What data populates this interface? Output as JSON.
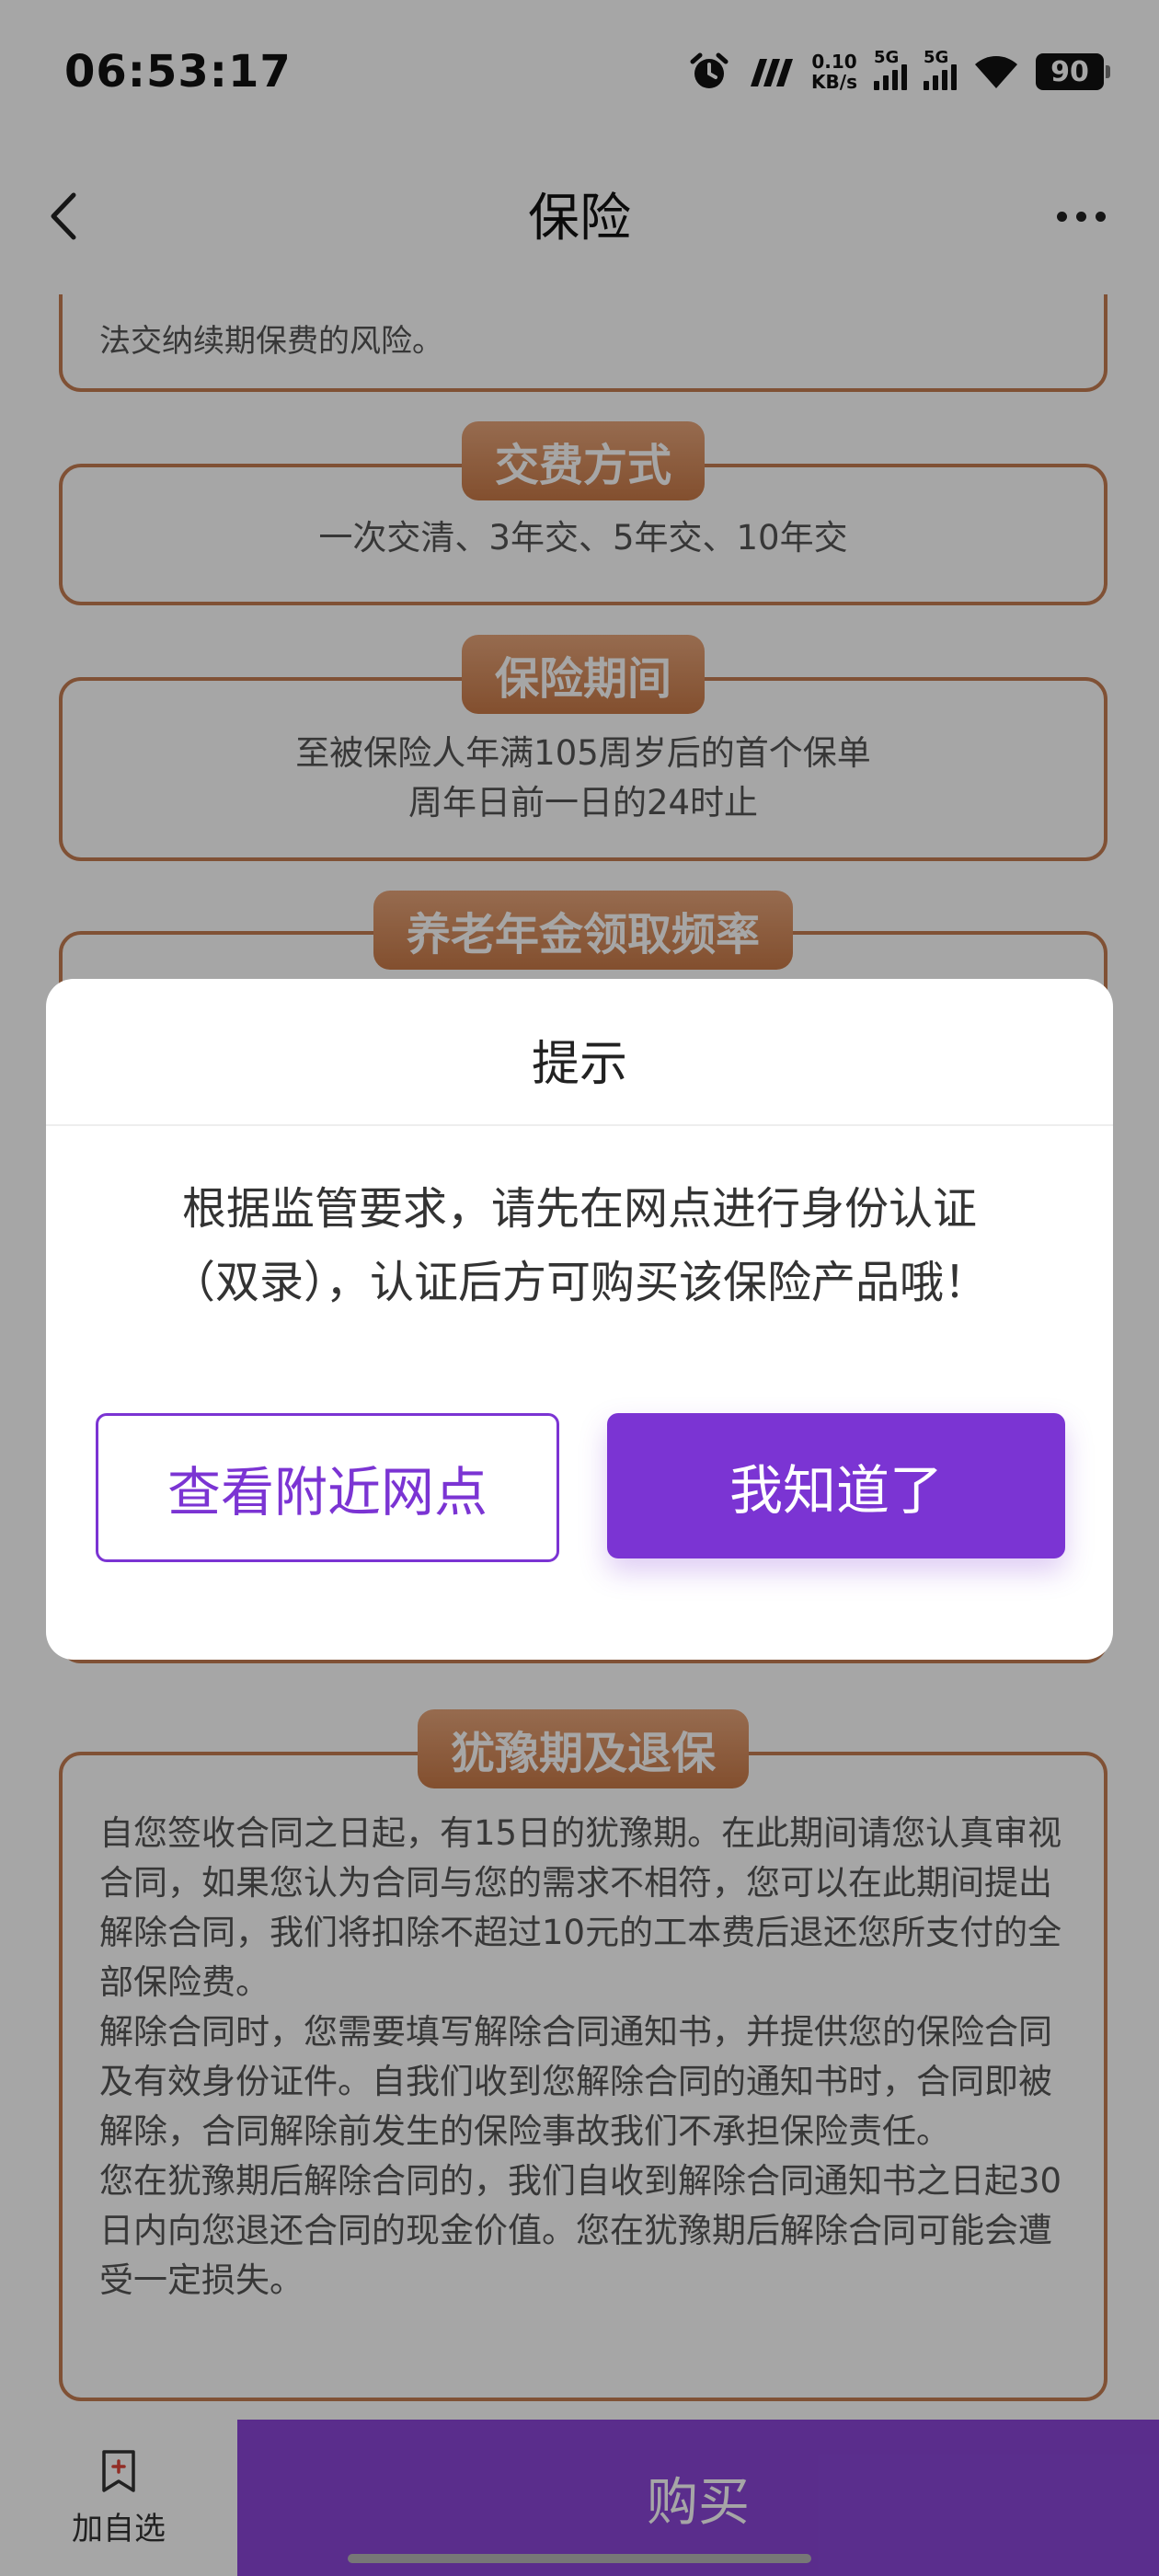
{
  "status_bar": {
    "time": "06:53:17",
    "net_speed_value": "0.10",
    "net_speed_unit": "KB/s",
    "signal_1_label": "5G",
    "signal_2_label": "5G",
    "battery": "90"
  },
  "nav": {
    "title": "保险"
  },
  "sections": {
    "partial_text": "法交纳续期保费的风险。",
    "payment_method": {
      "title": "交费方式",
      "text": "一次交清、3年交、5年交、10年交"
    },
    "insurance_period": {
      "title": "保险期间",
      "line1": "至被保险人年满105周岁后的首个保单",
      "line2": "周年日前一日的24时止"
    },
    "pension_frequency": {
      "title": "养老年金领取频率"
    },
    "cooling_off": {
      "title": "犹豫期及退保",
      "paragraphs": [
        "自您签收合同之日起，有15日的犹豫期。在此期间请您认真审视合同，如果您认为合同与您的需求不相符，您可以在此期间提出解除合同，我们将扣除不超过10元的工本费后退还您所支付的全部保险费。",
        "解除合同时，您需要填写解除合同通知书，并提供您的保险合同及有效身份证件。自我们收到您解除合同的通知书时，合同即被解除，合同解除前发生的保险事故我们不承担保险责任。",
        "您在犹豫期后解除合同的，我们自收到解除合同通知书之日起30日内向您退还合同的现金价值。您在犹豫期后解除合同可能会遭受一定损失。"
      ]
    }
  },
  "bottom_bar": {
    "favorite_label": "加自选",
    "buy_label": "购买"
  },
  "dialog": {
    "title": "提示",
    "message_line1": "根据监管要求，请先在网点进行身份认证",
    "message_line2": "（双录），认证后方可购买该保险产品哦！",
    "nearby_button": "查看附近网点",
    "ok_button": "我知道了"
  },
  "colors": {
    "brand_purple": "#7b34d3",
    "section_border": "#c57d52"
  }
}
